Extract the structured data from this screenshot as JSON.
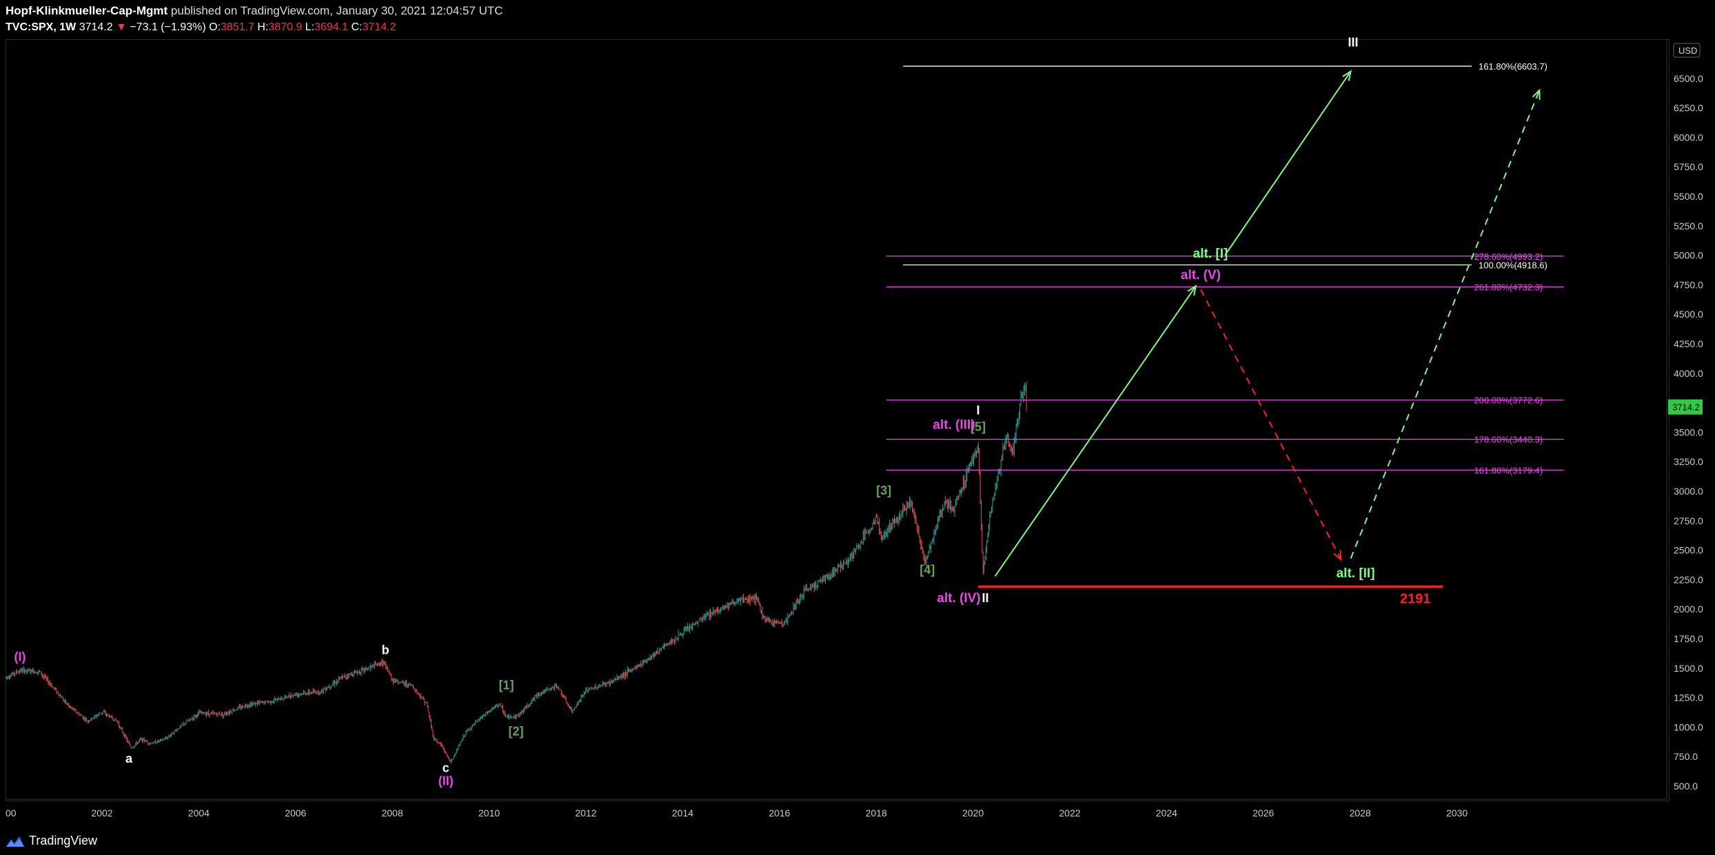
{
  "header": {
    "author": "Hopf-Klinkmueller-Cap-Mgmt",
    "published": "published on TradingView.com, January 30, 2021 12:04:57 UTC",
    "symbol": "TVC:SPX, 1W",
    "last": "3714.2",
    "arrow": "▼",
    "change": "−73.1 (−1.93%)",
    "o_label": "O:",
    "o_value": "3851.7",
    "h_label": "H:",
    "h_value": "3870.9",
    "l_label": "L:",
    "l_value": "3694.1",
    "c_label": "C:",
    "c_value": "3714.2"
  },
  "footer": {
    "brand": "TradingView"
  },
  "colors": {
    "up": "#26a69a",
    "down": "#ef5350",
    "green": "#7CFC7C",
    "magenta": "#ee44ee",
    "red": "#ff2020",
    "white": "#ffffff",
    "olive": "#5fa55a"
  },
  "chart_data": {
    "type": "line",
    "ylim": [
      400,
      6800
    ],
    "xlim": [
      2000,
      2032.2
    ],
    "currency": "USD",
    "price_label": "3714.2",
    "yticks": [
      500,
      750,
      1000,
      1250,
      1500,
      1750,
      2000,
      2250,
      2500,
      2750,
      3000,
      3250,
      3500,
      3750,
      4000,
      4250,
      4500,
      4750,
      5000,
      5250,
      5500,
      5750,
      6000,
      6250,
      6500
    ],
    "ytick_top_partial": "6",
    "xticks": [
      {
        "x": 2000,
        "label": "00"
      },
      {
        "x": 2002,
        "label": "2002"
      },
      {
        "x": 2004,
        "label": "2004"
      },
      {
        "x": 2006,
        "label": "2006"
      },
      {
        "x": 2008,
        "label": "2008"
      },
      {
        "x": 2010,
        "label": "2010"
      },
      {
        "x": 2012,
        "label": "2012"
      },
      {
        "x": 2014,
        "label": "2014"
      },
      {
        "x": 2016,
        "label": "2016"
      },
      {
        "x": 2018,
        "label": "2018"
      },
      {
        "x": 2020,
        "label": "2020"
      },
      {
        "x": 2022,
        "label": "2022"
      },
      {
        "x": 2024,
        "label": "2024"
      },
      {
        "x": 2026,
        "label": "2026"
      },
      {
        "x": 2028,
        "label": "2028"
      },
      {
        "x": 2030,
        "label": "2030"
      }
    ],
    "price_series": [
      [
        2000.0,
        1420
      ],
      [
        2000.3,
        1480
      ],
      [
        2000.7,
        1470
      ],
      [
        2001.0,
        1330
      ],
      [
        2001.3,
        1180
      ],
      [
        2001.7,
        1050
      ],
      [
        2002.0,
        1130
      ],
      [
        2002.3,
        1050
      ],
      [
        2002.6,
        820
      ],
      [
        2002.8,
        900
      ],
      [
        2003.0,
        860
      ],
      [
        2003.3,
        900
      ],
      [
        2003.6,
        1000
      ],
      [
        2004.0,
        1120
      ],
      [
        2004.5,
        1110
      ],
      [
        2005.0,
        1190
      ],
      [
        2005.5,
        1220
      ],
      [
        2006.0,
        1280
      ],
      [
        2006.5,
        1300
      ],
      [
        2007.0,
        1430
      ],
      [
        2007.5,
        1500
      ],
      [
        2007.8,
        1550
      ],
      [
        2008.0,
        1400
      ],
      [
        2008.4,
        1350
      ],
      [
        2008.7,
        1200
      ],
      [
        2008.85,
        900
      ],
      [
        2009.0,
        850
      ],
      [
        2009.2,
        700
      ],
      [
        2009.5,
        950
      ],
      [
        2009.8,
        1070
      ],
      [
        2010.2,
        1200
      ],
      [
        2010.35,
        1080
      ],
      [
        2010.6,
        1100
      ],
      [
        2011.0,
        1280
      ],
      [
        2011.4,
        1350
      ],
      [
        2011.7,
        1130
      ],
      [
        2012.0,
        1310
      ],
      [
        2012.5,
        1380
      ],
      [
        2013.0,
        1500
      ],
      [
        2013.5,
        1650
      ],
      [
        2014.0,
        1800
      ],
      [
        2014.5,
        1950
      ],
      [
        2015.0,
        2050
      ],
      [
        2015.5,
        2100
      ],
      [
        2015.7,
        1900
      ],
      [
        2016.1,
        1880
      ],
      [
        2016.5,
        2150
      ],
      [
        2017.0,
        2280
      ],
      [
        2017.5,
        2450
      ],
      [
        2018.0,
        2780
      ],
      [
        2018.1,
        2600
      ],
      [
        2018.7,
        2920
      ],
      [
        2019.0,
        2400
      ],
      [
        2019.4,
        2900
      ],
      [
        2019.6,
        2850
      ],
      [
        2020.0,
        3300
      ],
      [
        2020.1,
        3390
      ],
      [
        2020.2,
        2300
      ],
      [
        2020.35,
        2800
      ],
      [
        2020.5,
        3100
      ],
      [
        2020.7,
        3500
      ],
      [
        2020.8,
        3300
      ],
      [
        2021.0,
        3820
      ],
      [
        2021.08,
        3870
      ],
      [
        2021.1,
        3714
      ]
    ],
    "fib_levels": [
      {
        "label": "161.80%(6603.7)",
        "y": 6603.7,
        "x0": 2018.55,
        "x1": 2030.3,
        "color": "white",
        "label_x": 2030.3
      },
      {
        "label": "278.60%(4993.2)",
        "y": 4993.2,
        "x0": 2018.2,
        "x1": 2032.2,
        "color": "magenta",
        "label_x": 2032.2
      },
      {
        "label": "100.00%(4918.6)",
        "y": 4918.6,
        "x0": 2018.55,
        "x1": 2030.3,
        "color": "white",
        "label_x": 2030.3
      },
      {
        "label": "261.80%(4732.3)",
        "y": 4732.3,
        "x0": 2018.2,
        "x1": 2032.2,
        "color": "magenta",
        "label_x": 2032.2
      },
      {
        "label": "200.00%(3772.6)",
        "y": 3772.6,
        "x0": 2018.2,
        "x1": 2032.2,
        "color": "magenta",
        "label_x": 2032.2
      },
      {
        "label": "178.60%(3440.3)",
        "y": 3440.3,
        "x0": 2018.2,
        "x1": 2032.2,
        "color": "magenta",
        "label_x": 2032.2
      },
      {
        "label": "161.80%(3179.4)",
        "y": 3179.4,
        "x0": 2018.2,
        "x1": 2032.2,
        "color": "magenta",
        "label_x": 2032.2
      }
    ],
    "support": {
      "label": "2191",
      "y": 2191,
      "x0": 2020.1,
      "x1": 2029.7
    },
    "projections": [
      {
        "from": [
          2020.45,
          2280
        ],
        "to": [
          2024.6,
          4740
        ],
        "color": "green",
        "dashed": false
      },
      {
        "from": [
          2025.2,
          5000
        ],
        "to": [
          2027.8,
          6560
        ],
        "color": "green",
        "dashed": false
      },
      {
        "from": [
          2024.7,
          4710
        ],
        "to": [
          2027.6,
          2420
        ],
        "color": "red",
        "dashed": true
      },
      {
        "from": [
          2027.8,
          2430
        ],
        "to": [
          2031.7,
          6400
        ],
        "color": "green",
        "dashed": true
      }
    ],
    "annotations": [
      {
        "text": "(I)",
        "x": 2000.3,
        "y": 1560,
        "color": "magenta"
      },
      {
        "text": "a",
        "x": 2002.55,
        "y": 700,
        "color": "white"
      },
      {
        "text": "b",
        "x": 2007.85,
        "y": 1620,
        "color": "white"
      },
      {
        "text": "c",
        "x": 2009.1,
        "y": 620,
        "color": "white"
      },
      {
        "text": "(II)",
        "x": 2009.1,
        "y": 510,
        "color": "magenta"
      },
      {
        "text": "[1]",
        "x": 2010.35,
        "y": 1320,
        "color": "olive"
      },
      {
        "text": "[2]",
        "x": 2010.55,
        "y": 930,
        "color": "olive"
      },
      {
        "text": "[3]",
        "x": 2018.15,
        "y": 2970,
        "color": "olive"
      },
      {
        "text": "[4]",
        "x": 2019.05,
        "y": 2300,
        "color": "olive"
      },
      {
        "text": "[5]",
        "x": 2020.1,
        "y": 3510,
        "color": "olive"
      },
      {
        "text": "alt. (III)",
        "x": 2019.6,
        "y": 3530,
        "color": "magenta"
      },
      {
        "text": "I",
        "x": 2020.1,
        "y": 3650,
        "color": "white"
      },
      {
        "text": "alt. (IV)",
        "x": 2019.7,
        "y": 2060,
        "color": "magenta"
      },
      {
        "text": "II",
        "x": 2020.25,
        "y": 2060,
        "color": "white"
      },
      {
        "text": "alt. (V)",
        "x": 2024.7,
        "y": 4800,
        "color": "magenta"
      },
      {
        "text": "alt. [I]",
        "x": 2024.9,
        "y": 4980,
        "color": "green"
      },
      {
        "text": "III",
        "x": 2027.85,
        "y": 6770,
        "color": "white"
      },
      {
        "text": "alt. [II]",
        "x": 2027.9,
        "y": 2270,
        "color": "green"
      }
    ]
  }
}
